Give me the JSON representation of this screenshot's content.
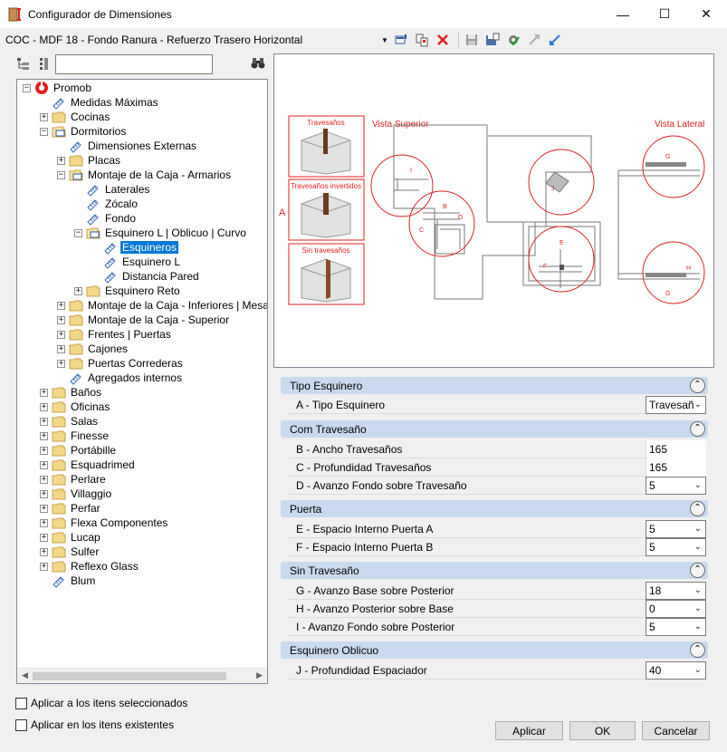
{
  "window": {
    "title": "Configurador de Dimensiones",
    "controls": {
      "minimize": "—",
      "maximize": "☐",
      "close": "✕"
    }
  },
  "toolbar": {
    "config_name": "COC - MDF 18 - Fondo Ranura - Refuerzo Trasero Horizontal"
  },
  "tree": {
    "items": [
      {
        "label": "Promob",
        "level": 0,
        "expander": "−",
        "icon": "promob-logo-icon"
      },
      {
        "label": "Medidas Máximas",
        "level": 1,
        "expander": "",
        "icon": "ruler-icon"
      },
      {
        "label": "Cocinas",
        "level": 1,
        "expander": "+",
        "icon": "folder-icon"
      },
      {
        "label": "Dormitorios",
        "level": 1,
        "expander": "−",
        "icon": "folder-open-icon"
      },
      {
        "label": "Dimensiones Externas",
        "level": 2,
        "expander": "",
        "icon": "ruler-icon"
      },
      {
        "label": "Placas",
        "level": 2,
        "expander": "+",
        "icon": "folder-icon"
      },
      {
        "label": "Montaje de la Caja - Armarios",
        "level": 2,
        "expander": "−",
        "icon": "folder-open-icon"
      },
      {
        "label": "Laterales",
        "level": 3,
        "expander": "",
        "icon": "ruler-icon"
      },
      {
        "label": "Zócalo",
        "level": 3,
        "expander": "",
        "icon": "ruler-icon"
      },
      {
        "label": "Fondo",
        "level": 3,
        "expander": "",
        "icon": "ruler-icon"
      },
      {
        "label": "Esquinero L | Oblicuo | Curvo",
        "level": 3,
        "expander": "−",
        "icon": "folder-open-icon"
      },
      {
        "label": "Esquineros",
        "level": 4,
        "expander": "",
        "icon": "ruler-icon",
        "selected": true
      },
      {
        "label": "Esquinero L",
        "level": 4,
        "expander": "",
        "icon": "ruler-icon"
      },
      {
        "label": "Distancia Pared",
        "level": 4,
        "expander": "",
        "icon": "ruler-icon"
      },
      {
        "label": "Esquinero Reto",
        "level": 3,
        "expander": "+",
        "icon": "folder-icon"
      },
      {
        "label": "Montaje de la Caja - Inferiores | Mesa de",
        "level": 2,
        "expander": "+",
        "icon": "folder-icon"
      },
      {
        "label": "Montaje de la Caja - Superior",
        "level": 2,
        "expander": "+",
        "icon": "folder-icon"
      },
      {
        "label": "Frentes | Puertas",
        "level": 2,
        "expander": "+",
        "icon": "folder-icon"
      },
      {
        "label": "Cajones",
        "level": 2,
        "expander": "+",
        "icon": "folder-icon"
      },
      {
        "label": "Puertas Correderas",
        "level": 2,
        "expander": "+",
        "icon": "folder-icon"
      },
      {
        "label": "Agregados internos",
        "level": 2,
        "expander": "",
        "icon": "ruler-icon"
      },
      {
        "label": "Baños",
        "level": 1,
        "expander": "+",
        "icon": "folder-icon"
      },
      {
        "label": "Oficinas",
        "level": 1,
        "expander": "+",
        "icon": "folder-icon"
      },
      {
        "label": "Salas",
        "level": 1,
        "expander": "+",
        "icon": "folder-icon"
      },
      {
        "label": "Finesse",
        "level": 1,
        "expander": "+",
        "icon": "folder-icon"
      },
      {
        "label": "Portábille",
        "level": 1,
        "expander": "+",
        "icon": "folder-icon"
      },
      {
        "label": "Esquadrimed",
        "level": 1,
        "expander": "+",
        "icon": "folder-icon"
      },
      {
        "label": "Perlare",
        "level": 1,
        "expander": "+",
        "icon": "folder-icon"
      },
      {
        "label": "Villaggio",
        "level": 1,
        "expander": "+",
        "icon": "folder-icon"
      },
      {
        "label": "Perfar",
        "level": 1,
        "expander": "+",
        "icon": "folder-icon"
      },
      {
        "label": "Flexa Componentes",
        "level": 1,
        "expander": "+",
        "icon": "folder-icon"
      },
      {
        "label": "Lucap",
        "level": 1,
        "expander": "+",
        "icon": "folder-icon"
      },
      {
        "label": "Sulfer",
        "level": 1,
        "expander": "+",
        "icon": "folder-icon"
      },
      {
        "label": "Reflexo Glass",
        "level": 1,
        "expander": "+",
        "icon": "folder-icon"
      },
      {
        "label": "Blum",
        "level": 1,
        "expander": "",
        "icon": "ruler-icon"
      }
    ]
  },
  "preview": {
    "label_travesanos": "Travesaños",
    "label_travesanos_invertidos": "Travesaños invertidos",
    "label_sin_travesanos": "Sin travesaños",
    "label_a": "A",
    "vista_superior": "Vista Superior",
    "vista_lateral": "Vista Lateral",
    "letters": {
      "b": "B",
      "c": "C",
      "d": "D",
      "e": "E",
      "f": "F",
      "g": "G",
      "h": "H",
      "i": "I",
      "j": "J"
    }
  },
  "sections": [
    {
      "title": "Tipo Esquinero",
      "toggle": "⌃",
      "rows": [
        {
          "label": "A -  Tipo Esquinero",
          "value": "Travesañ",
          "dropdown": true
        }
      ]
    },
    {
      "title": "Com Travesaño",
      "toggle": "⌃",
      "rows": [
        {
          "label": "B - Ancho Travesaños",
          "value": "165",
          "dropdown": false
        },
        {
          "label": "C - Profundidad Travesaños",
          "value": "165",
          "dropdown": false
        },
        {
          "label": "D - Avanzo Fondo sobre Travesaño",
          "value": "5",
          "dropdown": true
        }
      ]
    },
    {
      "title": "Puerta",
      "toggle": "⌃",
      "rows": [
        {
          "label": "E - Espacio Interno Puerta A",
          "value": "5",
          "dropdown": true
        },
        {
          "label": "F - Espacio Interno Puerta B",
          "value": "5",
          "dropdown": true
        }
      ]
    },
    {
      "title": "Sin Travesaño",
      "toggle": "⌃",
      "rows": [
        {
          "label": "G - Avanzo Base sobre Posterior",
          "value": "18",
          "dropdown": true
        },
        {
          "label": "H - Avanzo Posterior sobre Base",
          "value": "0",
          "dropdown": true
        },
        {
          "label": "I - Avanzo Fondo sobre Posterior",
          "value": "5",
          "dropdown": true
        }
      ]
    },
    {
      "title": "Esquinero Oblicuo",
      "toggle": "⌃",
      "rows": [
        {
          "label": "J - Profundidad Espaciador",
          "value": "40",
          "dropdown": true
        }
      ]
    }
  ],
  "options": {
    "apply_selected": "Aplicar a los itens seleccionados",
    "apply_existing": "Aplicar en los itens existentes"
  },
  "buttons": {
    "apply": "Aplicar",
    "ok": "OK",
    "cancel": "Cancelar"
  },
  "colors": {
    "accent_red": "#e02020",
    "selection_blue": "#0078d7",
    "section_header": "#c9daef"
  }
}
